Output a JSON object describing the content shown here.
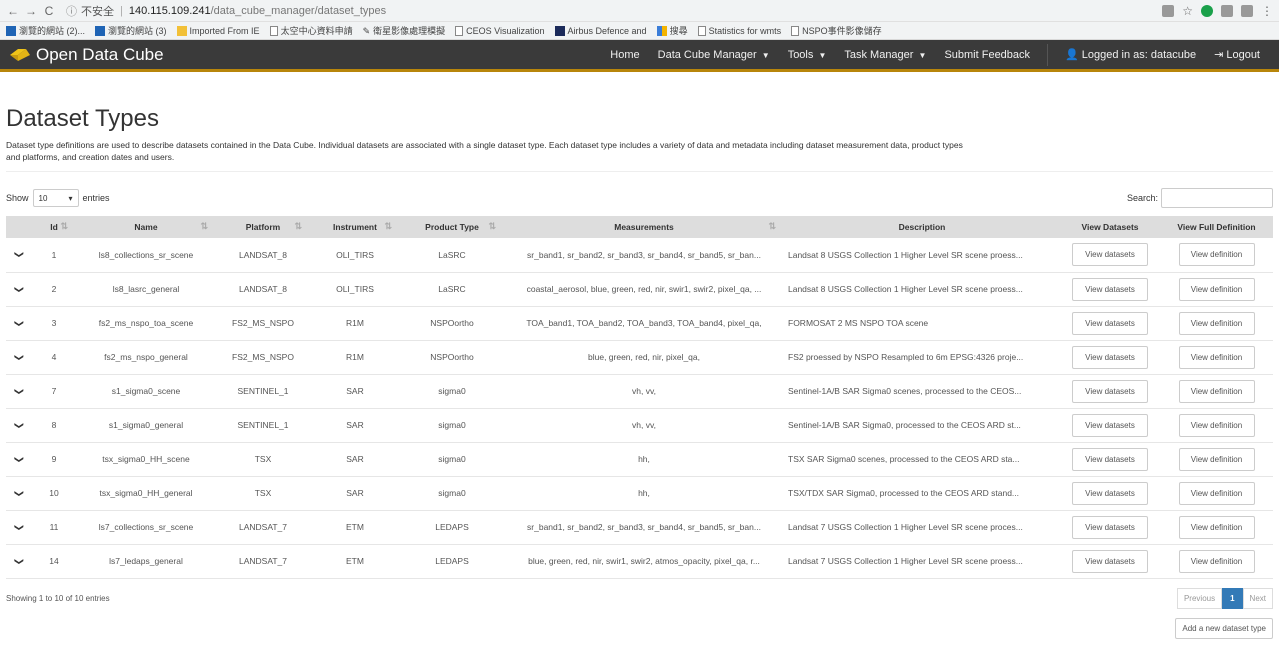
{
  "browser": {
    "security_label": "不安全",
    "host": "140.115.109.241",
    "path": "/data_cube_manager/dataset_types",
    "bookmarks": [
      "瀏覽的網站 (2)...",
      "瀏覽的網站 (3)",
      "Imported From IE",
      "太空中心資料申請",
      "衛星影像處理模擬",
      "CEOS Visualization",
      "Airbus Defence and",
      "搜尋",
      "Statistics for wmts",
      "NSPO事件影像儲存"
    ]
  },
  "navbar": {
    "brand": "Open Data Cube",
    "links": [
      "Home",
      "Data Cube Manager",
      "Tools",
      "Task Manager",
      "Submit Feedback"
    ],
    "user": "Logged in as: datacube",
    "logout": "Logout"
  },
  "page": {
    "title": "Dataset Types",
    "description": "Dataset type definitions are used to describe datasets contained in the Data Cube. Individual datasets are associated with a single dataset type. Each dataset type includes a variety of data and metadata including dataset measurement data, product types and platforms, and creation dates and users."
  },
  "table_controls": {
    "show_label": "Show",
    "length_value": "10",
    "entries_label": "entries",
    "search_label": "Search:"
  },
  "columns": [
    "Id",
    "Name",
    "Platform",
    "Instrument",
    "Product Type",
    "Measurements",
    "Description",
    "View Datasets",
    "View Full Definition"
  ],
  "rows": [
    {
      "id": "1",
      "name": "ls8_collections_sr_scene",
      "platform": "LANDSAT_8",
      "instrument": "OLI_TIRS",
      "product_type": "LaSRC",
      "measurements": "sr_band1, sr_band2, sr_band3, sr_band4, sr_band5, sr_ban...",
      "description": "Landsat 8 USGS Collection 1 Higher Level SR scene proess..."
    },
    {
      "id": "2",
      "name": "ls8_lasrc_general",
      "platform": "LANDSAT_8",
      "instrument": "OLI_TIRS",
      "product_type": "LaSRC",
      "measurements": "coastal_aerosol, blue, green, red, nir, swir1, swir2, pixel_qa, ...",
      "description": "Landsat 8 USGS Collection 1 Higher Level SR scene proess..."
    },
    {
      "id": "3",
      "name": "fs2_ms_nspo_toa_scene",
      "platform": "FS2_MS_NSPO",
      "instrument": "R1M",
      "product_type": "NSPOortho",
      "measurements": "TOA_band1, TOA_band2, TOA_band3, TOA_band4, pixel_qa,",
      "description": "FORMOSAT 2 MS NSPO TOA scene"
    },
    {
      "id": "4",
      "name": "fs2_ms_nspo_general",
      "platform": "FS2_MS_NSPO",
      "instrument": "R1M",
      "product_type": "NSPOortho",
      "measurements": "blue, green, red, nir, pixel_qa,",
      "description": "FS2 proessed by NSPO Resampled to 6m EPSG:4326 proje..."
    },
    {
      "id": "7",
      "name": "s1_sigma0_scene",
      "platform": "SENTINEL_1",
      "instrument": "SAR",
      "product_type": "sigma0",
      "measurements": "vh, vv,",
      "description": "Sentinel-1A/B SAR Sigma0 scenes, processed to the CEOS..."
    },
    {
      "id": "8",
      "name": "s1_sigma0_general",
      "platform": "SENTINEL_1",
      "instrument": "SAR",
      "product_type": "sigma0",
      "measurements": "vh, vv,",
      "description": "Sentinel-1A/B SAR Sigma0, processed to the CEOS ARD st..."
    },
    {
      "id": "9",
      "name": "tsx_sigma0_HH_scene",
      "platform": "TSX",
      "instrument": "SAR",
      "product_type": "sigma0",
      "measurements": "hh,",
      "description": "TSX SAR Sigma0 scenes, processed to the CEOS ARD sta..."
    },
    {
      "id": "10",
      "name": "tsx_sigma0_HH_general",
      "platform": "TSX",
      "instrument": "SAR",
      "product_type": "sigma0",
      "measurements": "hh,",
      "description": "TSX/TDX SAR Sigma0, processed to the CEOS ARD stand..."
    },
    {
      "id": "11",
      "name": "ls7_collections_sr_scene",
      "platform": "LANDSAT_7",
      "instrument": "ETM",
      "product_type": "LEDAPS",
      "measurements": "sr_band1, sr_band2, sr_band3, sr_band4, sr_band5, sr_ban...",
      "description": "Landsat 7 USGS Collection 1 Higher Level SR scene proces..."
    },
    {
      "id": "14",
      "name": "ls7_ledaps_general",
      "platform": "LANDSAT_7",
      "instrument": "ETM",
      "product_type": "LEDAPS",
      "measurements": "blue, green, red, nir, swir1, swir2, atmos_opacity, pixel_qa, r...",
      "description": "Landsat 7 USGS Collection 1 Higher Level SR scene proess..."
    }
  ],
  "row_buttons": {
    "view_datasets": "View datasets",
    "view_definition": "View definition"
  },
  "footer": {
    "info": "Showing 1 to 10 of 10 entries",
    "previous": "Previous",
    "current_page": "1",
    "next": "Next",
    "add_button": "Add a new dataset type"
  },
  "colors": {
    "navbar_bg": "#3a3a3a",
    "navbar_accent": "#b8860b",
    "header_bg": "#dddddd",
    "pager_active": "#337ab7"
  }
}
